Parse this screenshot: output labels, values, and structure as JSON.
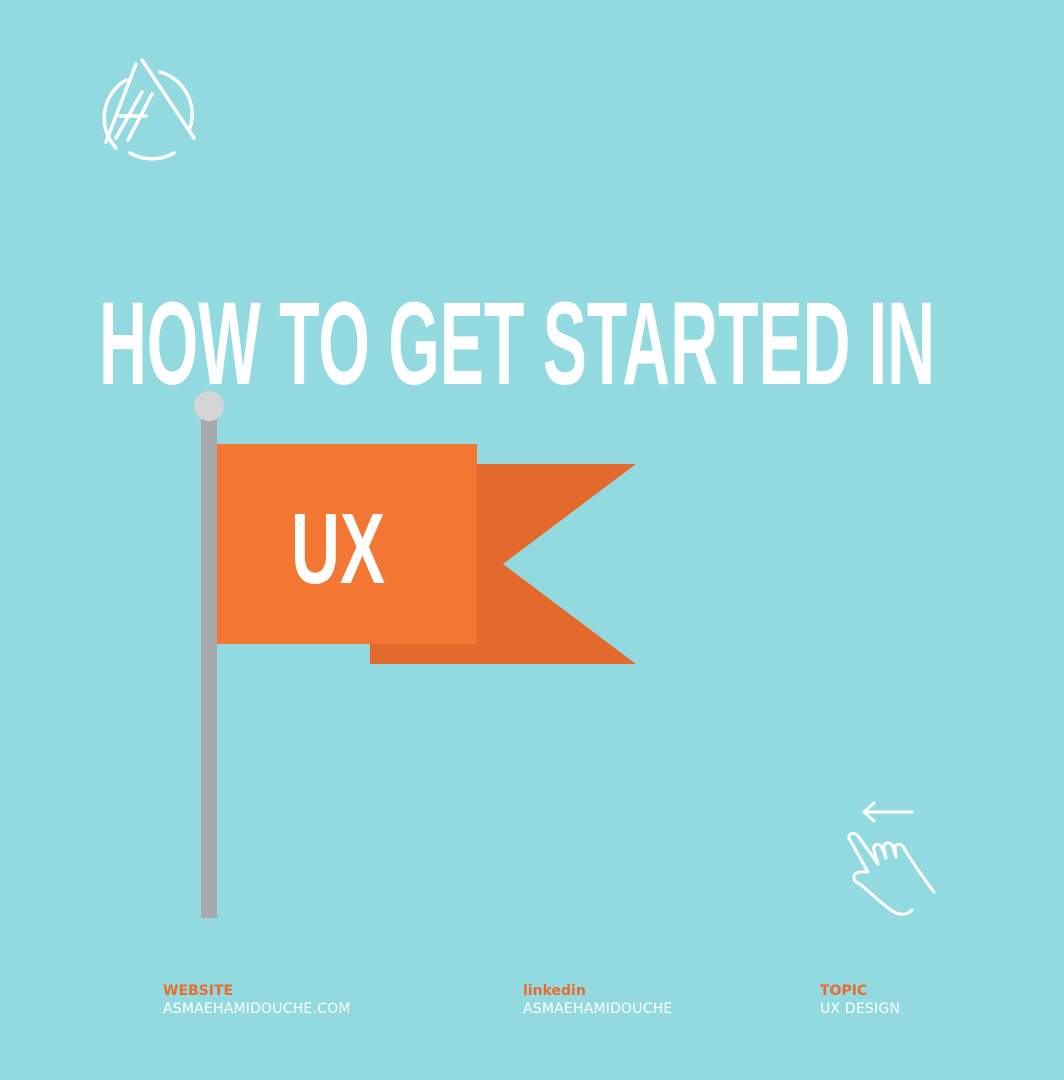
{
  "colors": {
    "background": "#92DAE0",
    "headline": "#FFFFFF",
    "flag_front": "#F47633",
    "flag_back": "#E36A2C",
    "pole": "#A7A9AA",
    "pole_cap": "#D3D5D6",
    "footer_label": "#EB6B2E",
    "footer_value": "#FFFFFF"
  },
  "branding": {
    "logo_icon": "ah-monogram-logo-icon"
  },
  "hero": {
    "headline": "HOW TO GET STARTED IN",
    "flag_text": "UX"
  },
  "swipe_hint": {
    "icon": "swipe-left-hand-icon"
  },
  "footer": {
    "website": {
      "label": "WEBSITE",
      "value": "ASMAEHAMIDOUCHE.COM"
    },
    "linkedin": {
      "label": "linkedin",
      "value": "ASMAEHAMIDOUCHE"
    },
    "topic": {
      "label": "TOPIC",
      "value": "UX DESIGN"
    }
  }
}
